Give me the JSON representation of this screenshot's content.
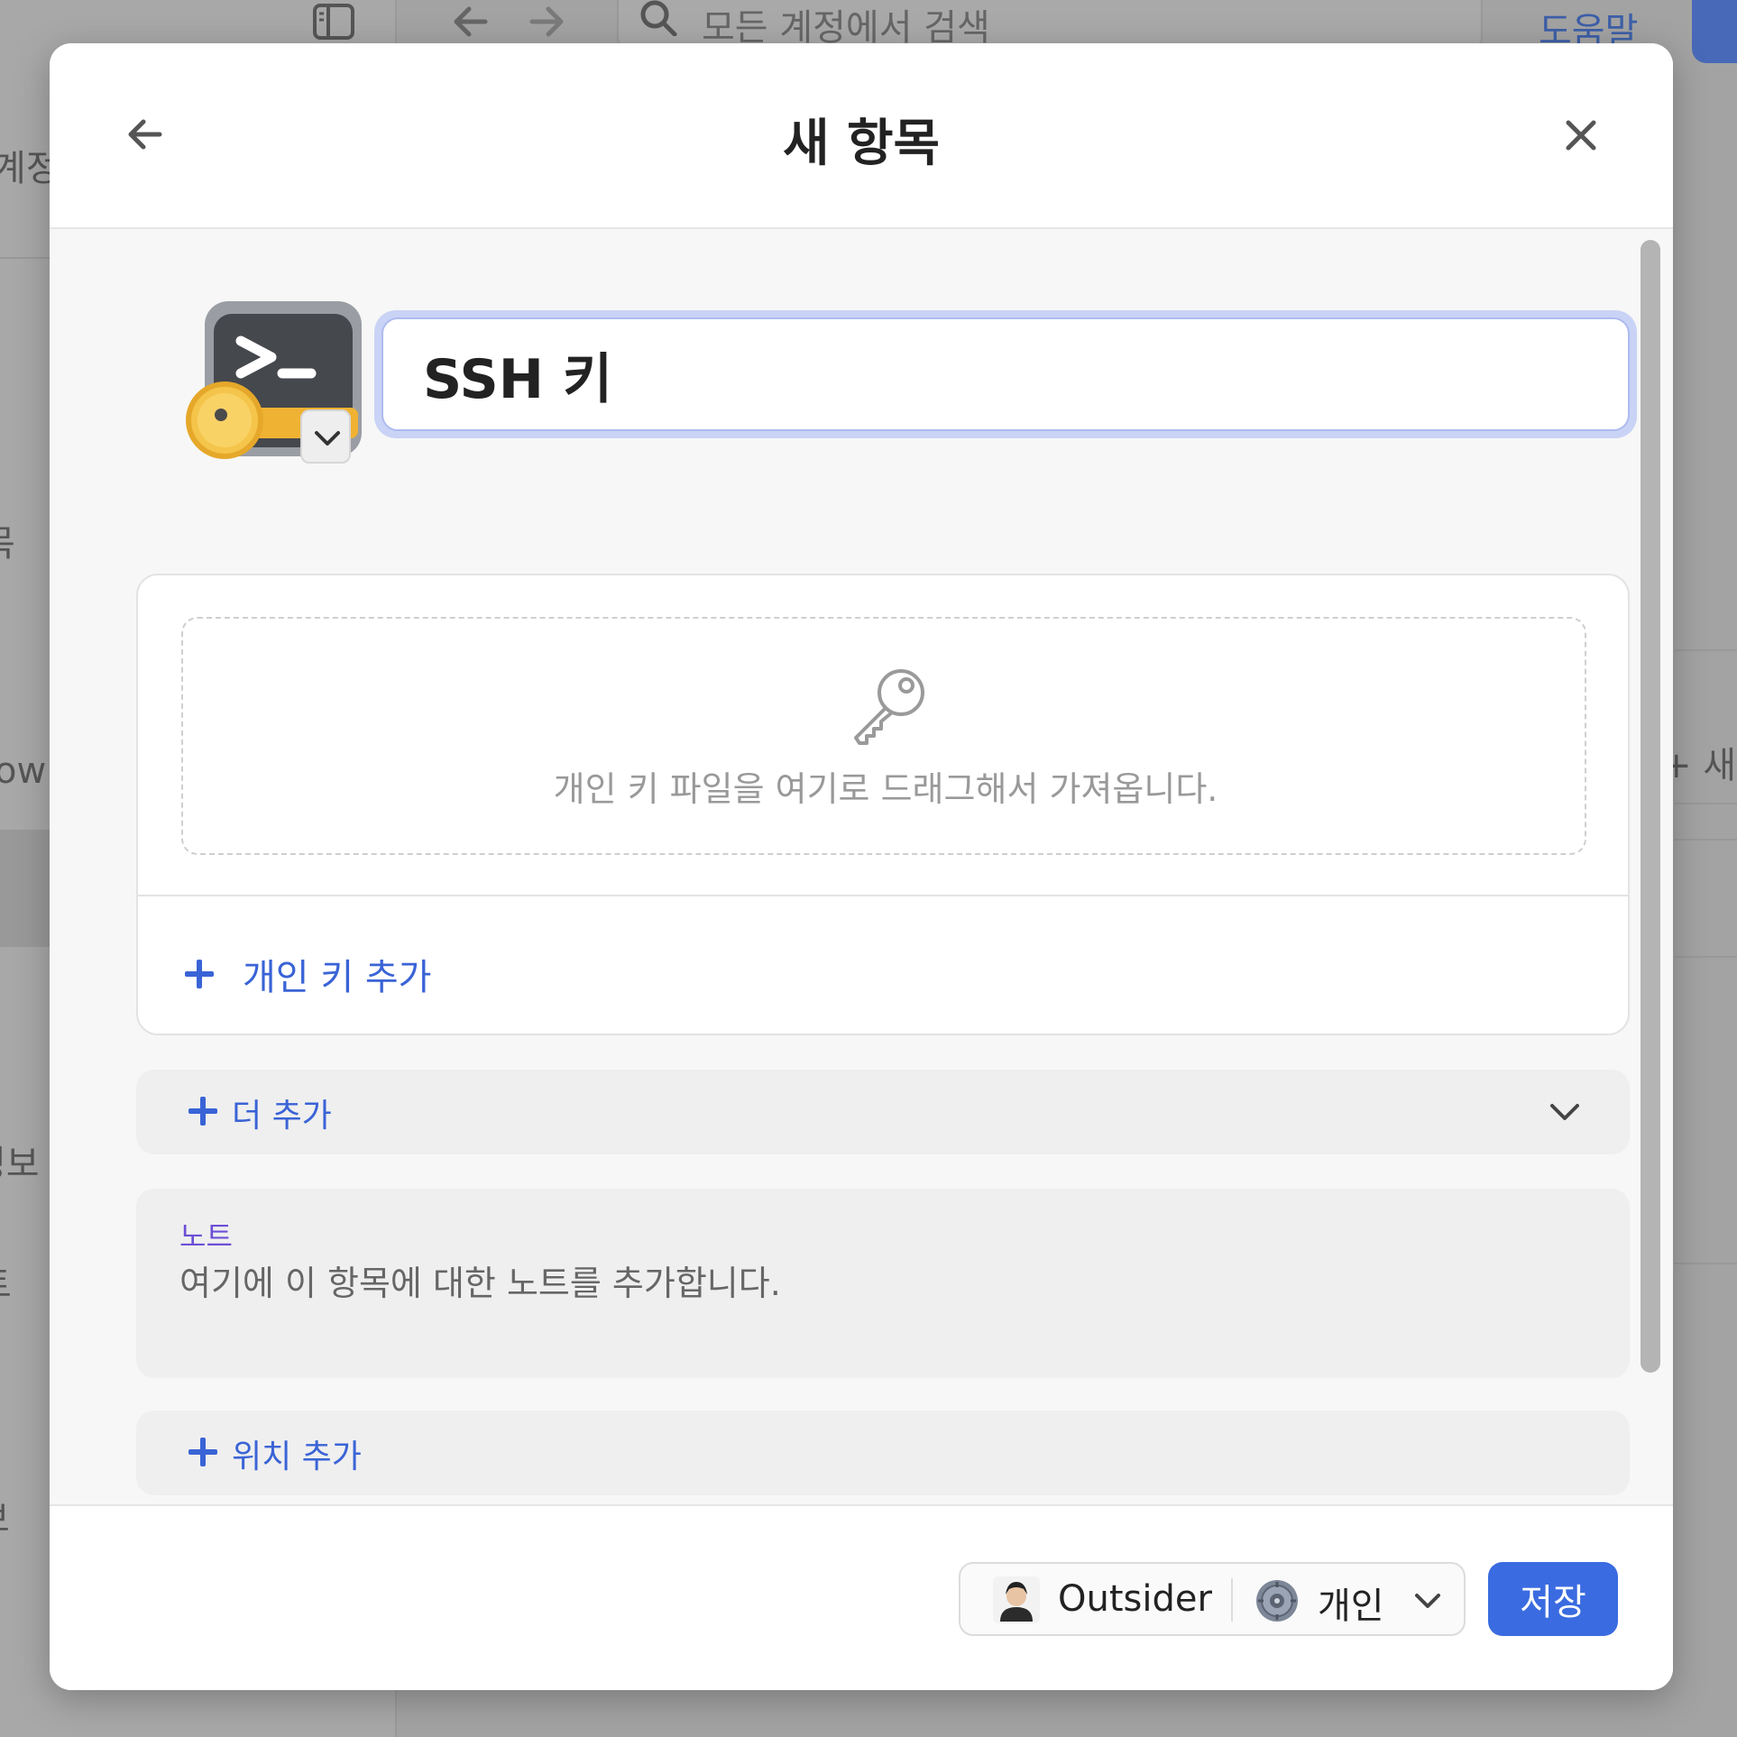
{
  "background": {
    "search_placeholder": "모든 계정에서 검색",
    "help_label": "도움말",
    "sidebar_fragments": [
      "계정",
      "목",
      "ow",
      "정보",
      "트",
      "보"
    ],
    "right_fragment": "+ 새"
  },
  "modal": {
    "title": "새 항목",
    "item": {
      "name": "SSH 키",
      "icon": "ssh-key-terminal-icon"
    },
    "dropzone": {
      "text": "개인 키 파일을 여기로 드래그해서 가져옵니다."
    },
    "add_private_key_label": "개인 키 추가",
    "add_more_label": "더 추가",
    "notes": {
      "label": "노트",
      "placeholder": "여기에 이 항목에 대한 노트를 추가합니다."
    },
    "add_location_label": "위치 추가",
    "footer": {
      "account_name": "Outsider",
      "vault_name": "개인",
      "save_label": "저장"
    }
  },
  "colors": {
    "accent": "#3a6be0",
    "link": "#3a63d6",
    "notes_label": "#6c4fd6",
    "input_focus": "#c9d3f6"
  }
}
